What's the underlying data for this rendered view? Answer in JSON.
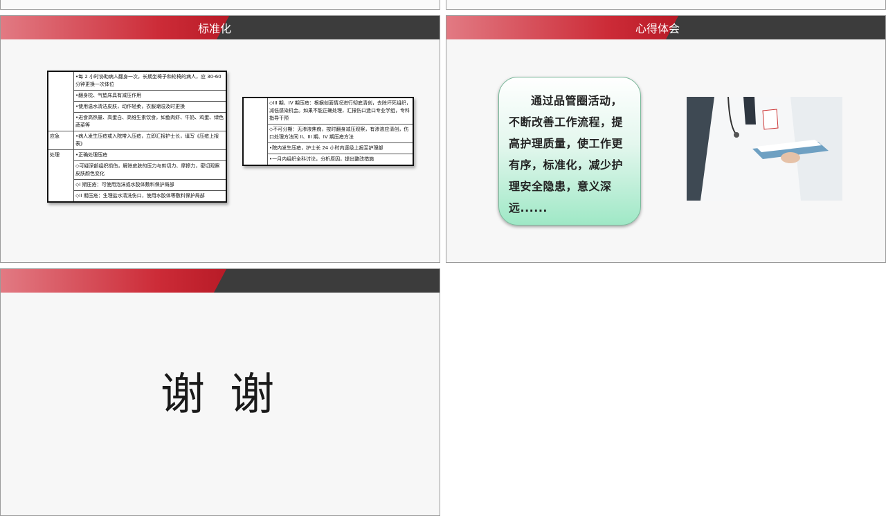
{
  "slides": [
    {
      "title": "标准化",
      "left_table": {
        "rows": [
          {
            "label": "",
            "text": "•每 2 小时协助病人翻身一次，长期坐椅子和轮椅的病人，应 30-60 分钟更换一次体位"
          },
          {
            "label": "",
            "text": "•翻身枕、气垫床具有减压作用"
          },
          {
            "label": "",
            "text": "•使用温水清洁皮肤，动作轻柔，衣服潮湿及时更换"
          },
          {
            "label": "",
            "text": "•进食高热量、高蛋白、高维生素饮食，如鱼肉虾、牛奶、鸡蛋、绿色蔬菜等"
          },
          {
            "label": "应急",
            "text": "•病人发生压疮或入院带入压疮，立即汇报护士长，填写《压疮上报表》"
          },
          {
            "label": "处理",
            "text": "•正确处理压疮"
          },
          {
            "label": "",
            "text": "◇可疑深部组织损伤，解除皮肤的压力与剪切力、摩擦力，密切观察皮肤颜色变化"
          },
          {
            "label": "",
            "text": "◇I 期压疮：可使用泡沫或水胶体敷料保护局部"
          },
          {
            "label": "",
            "text": "◇II 期压疮：生理盐水清洗伤口，使用水胶体等敷料保护局部"
          }
        ]
      },
      "right_table": {
        "rows": [
          {
            "text": "◇III 期、IV 期压疮：根据创面情况进行彻底清创，去除坏死组织，减低感染机会。如果不能正确处理，汇报伤口造口专业学组，专科指导干预"
          },
          {
            "text": "◇不可分期：无渗液焦痂，按时翻身减压观察，有渗液应清创，伤口处理方法同 II、III 期、IV 期压疮方法"
          },
          {
            "text": "•院内发生压疮，护士长 24 小时内逐级上报至护理部"
          },
          {
            "text": "•一月内组织全科讨论，分析原因，提出整改措施"
          }
        ]
      }
    },
    {
      "title": "心得体会",
      "bubble_text": "通过品管圈活动，不断改善工作流程，提高护理质量，使工作更有序，标准化，减少护理安全隐患，意义深远......"
    },
    {
      "title": "",
      "thanks_text": "谢 谢"
    }
  ],
  "colors": {
    "header_red": "#cc2b37",
    "header_dark": "#3c3c3c",
    "bubble_green": "#9fe8c6"
  }
}
